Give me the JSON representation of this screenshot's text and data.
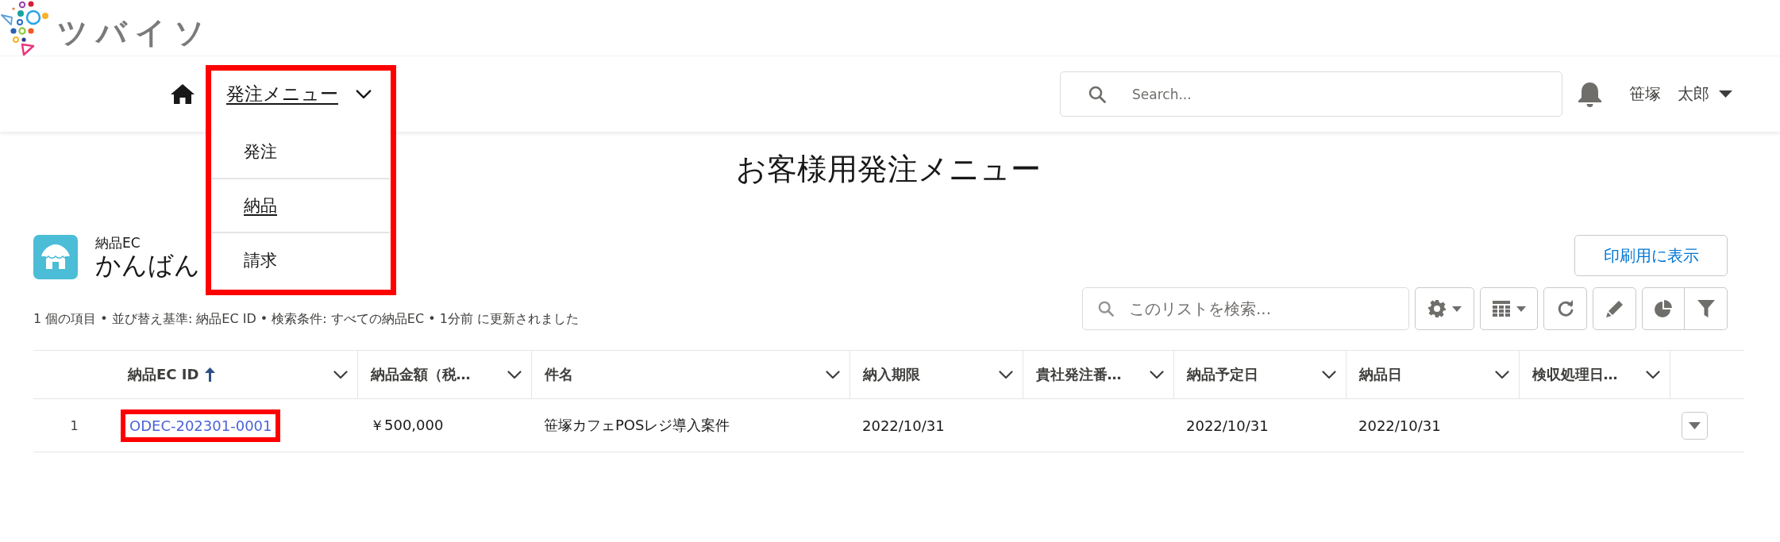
{
  "logo": {
    "text": "ツバイソ"
  },
  "nav": {
    "menu": {
      "label": "発注メニュー",
      "expanded": true,
      "highlighted": true,
      "items": [
        {
          "label": "発注",
          "hovered": false
        },
        {
          "label": "納品",
          "hovered": true
        },
        {
          "label": "請求",
          "hovered": false
        }
      ]
    },
    "search": {
      "placeholder": "Search..."
    },
    "user": {
      "family_name": "笹塚",
      "given_name": "太郎"
    }
  },
  "page_title": "お客様用発注メニュー",
  "list_header": {
    "object_label": "納品EC",
    "title": "かんばん",
    "print_button": "印刷用に表示"
  },
  "list_info": "1 個の項目 • 並び替え基準: 納品EC ID • 検索条件: すべての納品EC • 1分前 に更新されました",
  "list_search": {
    "placeholder": "このリストを検索..."
  },
  "table": {
    "columns": [
      {
        "label": "納品EC ID",
        "sorted": true
      },
      {
        "label": "納品金額（税…",
        "sorted": false
      },
      {
        "label": "件名",
        "sorted": false
      },
      {
        "label": "納入期限",
        "sorted": false
      },
      {
        "label": "貴社発注番…",
        "sorted": false
      },
      {
        "label": "納品予定日",
        "sorted": false
      },
      {
        "label": "納品日",
        "sorted": false
      },
      {
        "label": "検収処理日…",
        "sorted": false
      }
    ],
    "rows": [
      {
        "number": "1",
        "cells": [
          {
            "kind": "link",
            "text": "ODEC-202301-0001",
            "highlighted": true
          },
          {
            "kind": "text",
            "text": "￥500,000",
            "highlighted": false
          },
          {
            "kind": "text",
            "text": "笹塚カフェPOSレジ導入案件",
            "highlighted": false
          },
          {
            "kind": "text",
            "text": "2022/10/31",
            "highlighted": false
          },
          {
            "kind": "empty"
          },
          {
            "kind": "text",
            "text": "2022/10/31",
            "highlighted": false
          },
          {
            "kind": "text",
            "text": "2022/10/31",
            "highlighted": false
          },
          {
            "kind": "empty"
          }
        ]
      }
    ]
  }
}
